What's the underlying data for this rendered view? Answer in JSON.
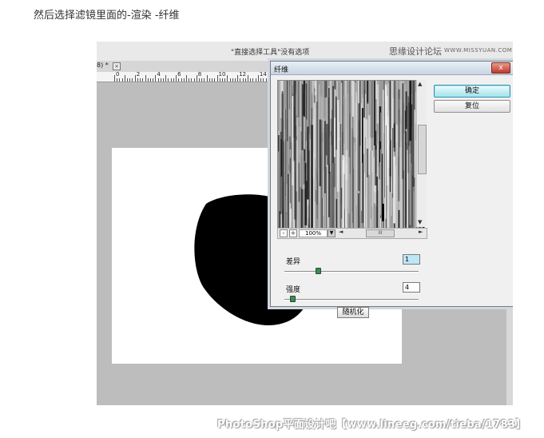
{
  "caption": "然后选择滤镜里面的-渲染 -纤维",
  "ps": {
    "title": "\"直接选择工具\"没有选项",
    "brand": "思缘设计论坛",
    "brand_url": "WWW.MISSYUAN.COM",
    "doc_tab_label": "8) *",
    "doc_tab_close": "×",
    "ruler_numbers": [
      "0",
      "2",
      "4",
      "6",
      "8",
      "10",
      "12",
      "14"
    ]
  },
  "dialog": {
    "title": "纤维",
    "close": "x",
    "ok_label": "确定",
    "reset_label": "复位",
    "zoom_value": "100%",
    "zoom_out": "-",
    "zoom_in": "+",
    "hscroll_thumb_glyph": "III",
    "params": [
      {
        "label": "差异",
        "value": "1"
      },
      {
        "label": "强度",
        "value": "4"
      }
    ],
    "randomize_label": "随机化",
    "slider_levels": [
      0.25,
      0.06
    ],
    "colors": {
      "ok_button": "#9fe3ee",
      "slider_thumb": "#3d8a53"
    }
  },
  "watermark": "PhotoShop平面设计吧【www.lineeg.com/tieba/1783】"
}
